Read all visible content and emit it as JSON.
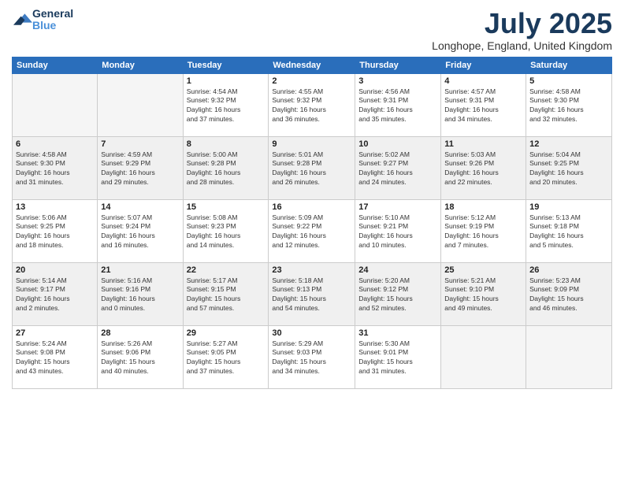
{
  "logo": {
    "text_general": "General",
    "text_blue": "Blue"
  },
  "title": "July 2025",
  "location": "Longhope, England, United Kingdom",
  "headers": [
    "Sunday",
    "Monday",
    "Tuesday",
    "Wednesday",
    "Thursday",
    "Friday",
    "Saturday"
  ],
  "weeks": [
    {
      "shaded": false,
      "days": [
        {
          "num": "",
          "info": ""
        },
        {
          "num": "",
          "info": ""
        },
        {
          "num": "1",
          "info": "Sunrise: 4:54 AM\nSunset: 9:32 PM\nDaylight: 16 hours\nand 37 minutes."
        },
        {
          "num": "2",
          "info": "Sunrise: 4:55 AM\nSunset: 9:32 PM\nDaylight: 16 hours\nand 36 minutes."
        },
        {
          "num": "3",
          "info": "Sunrise: 4:56 AM\nSunset: 9:31 PM\nDaylight: 16 hours\nand 35 minutes."
        },
        {
          "num": "4",
          "info": "Sunrise: 4:57 AM\nSunset: 9:31 PM\nDaylight: 16 hours\nand 34 minutes."
        },
        {
          "num": "5",
          "info": "Sunrise: 4:58 AM\nSunset: 9:30 PM\nDaylight: 16 hours\nand 32 minutes."
        }
      ]
    },
    {
      "shaded": true,
      "days": [
        {
          "num": "6",
          "info": "Sunrise: 4:58 AM\nSunset: 9:30 PM\nDaylight: 16 hours\nand 31 minutes."
        },
        {
          "num": "7",
          "info": "Sunrise: 4:59 AM\nSunset: 9:29 PM\nDaylight: 16 hours\nand 29 minutes."
        },
        {
          "num": "8",
          "info": "Sunrise: 5:00 AM\nSunset: 9:28 PM\nDaylight: 16 hours\nand 28 minutes."
        },
        {
          "num": "9",
          "info": "Sunrise: 5:01 AM\nSunset: 9:28 PM\nDaylight: 16 hours\nand 26 minutes."
        },
        {
          "num": "10",
          "info": "Sunrise: 5:02 AM\nSunset: 9:27 PM\nDaylight: 16 hours\nand 24 minutes."
        },
        {
          "num": "11",
          "info": "Sunrise: 5:03 AM\nSunset: 9:26 PM\nDaylight: 16 hours\nand 22 minutes."
        },
        {
          "num": "12",
          "info": "Sunrise: 5:04 AM\nSunset: 9:25 PM\nDaylight: 16 hours\nand 20 minutes."
        }
      ]
    },
    {
      "shaded": false,
      "days": [
        {
          "num": "13",
          "info": "Sunrise: 5:06 AM\nSunset: 9:25 PM\nDaylight: 16 hours\nand 18 minutes."
        },
        {
          "num": "14",
          "info": "Sunrise: 5:07 AM\nSunset: 9:24 PM\nDaylight: 16 hours\nand 16 minutes."
        },
        {
          "num": "15",
          "info": "Sunrise: 5:08 AM\nSunset: 9:23 PM\nDaylight: 16 hours\nand 14 minutes."
        },
        {
          "num": "16",
          "info": "Sunrise: 5:09 AM\nSunset: 9:22 PM\nDaylight: 16 hours\nand 12 minutes."
        },
        {
          "num": "17",
          "info": "Sunrise: 5:10 AM\nSunset: 9:21 PM\nDaylight: 16 hours\nand 10 minutes."
        },
        {
          "num": "18",
          "info": "Sunrise: 5:12 AM\nSunset: 9:19 PM\nDaylight: 16 hours\nand 7 minutes."
        },
        {
          "num": "19",
          "info": "Sunrise: 5:13 AM\nSunset: 9:18 PM\nDaylight: 16 hours\nand 5 minutes."
        }
      ]
    },
    {
      "shaded": true,
      "days": [
        {
          "num": "20",
          "info": "Sunrise: 5:14 AM\nSunset: 9:17 PM\nDaylight: 16 hours\nand 2 minutes."
        },
        {
          "num": "21",
          "info": "Sunrise: 5:16 AM\nSunset: 9:16 PM\nDaylight: 16 hours\nand 0 minutes."
        },
        {
          "num": "22",
          "info": "Sunrise: 5:17 AM\nSunset: 9:15 PM\nDaylight: 15 hours\nand 57 minutes."
        },
        {
          "num": "23",
          "info": "Sunrise: 5:18 AM\nSunset: 9:13 PM\nDaylight: 15 hours\nand 54 minutes."
        },
        {
          "num": "24",
          "info": "Sunrise: 5:20 AM\nSunset: 9:12 PM\nDaylight: 15 hours\nand 52 minutes."
        },
        {
          "num": "25",
          "info": "Sunrise: 5:21 AM\nSunset: 9:10 PM\nDaylight: 15 hours\nand 49 minutes."
        },
        {
          "num": "26",
          "info": "Sunrise: 5:23 AM\nSunset: 9:09 PM\nDaylight: 15 hours\nand 46 minutes."
        }
      ]
    },
    {
      "shaded": false,
      "days": [
        {
          "num": "27",
          "info": "Sunrise: 5:24 AM\nSunset: 9:08 PM\nDaylight: 15 hours\nand 43 minutes."
        },
        {
          "num": "28",
          "info": "Sunrise: 5:26 AM\nSunset: 9:06 PM\nDaylight: 15 hours\nand 40 minutes."
        },
        {
          "num": "29",
          "info": "Sunrise: 5:27 AM\nSunset: 9:05 PM\nDaylight: 15 hours\nand 37 minutes."
        },
        {
          "num": "30",
          "info": "Sunrise: 5:29 AM\nSunset: 9:03 PM\nDaylight: 15 hours\nand 34 minutes."
        },
        {
          "num": "31",
          "info": "Sunrise: 5:30 AM\nSunset: 9:01 PM\nDaylight: 15 hours\nand 31 minutes."
        },
        {
          "num": "",
          "info": ""
        },
        {
          "num": "",
          "info": ""
        }
      ]
    }
  ]
}
